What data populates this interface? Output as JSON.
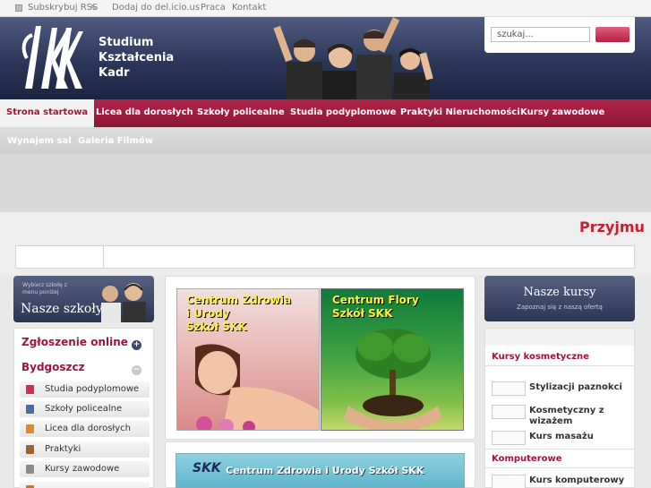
{
  "top_links": {
    "rss": "Subskrybuj RSS",
    "delicious": "Dodaj do del.icio.us",
    "praca": "Praca",
    "kontakt": "Kontakt"
  },
  "logo": {
    "mark": "SKK",
    "line1": "Studium",
    "line2": "Kształcenia",
    "line3": "Kadr"
  },
  "search": {
    "placeholder": "szukaj..."
  },
  "nav": {
    "row1": [
      "Strona startowa",
      "Licea dla dorosłych",
      "Szkoły policealne",
      "Studia podyplomowe",
      "Praktyki Nieruchomości",
      "Kursy zawodowe"
    ],
    "row2": [
      "Wynajem sal",
      "Galeria Filmów"
    ],
    "active": "Strona startowa"
  },
  "marquee": {
    "text": "Przyjmu"
  },
  "left_banner": {
    "small_line1": "Wybierz szkołę z",
    "small_line2": "menu poniżej",
    "title": "Nasze szkoły"
  },
  "left_panel": {
    "zgloszenie": "Zgłoszenie online",
    "city": "Bydgoszcz",
    "items": [
      {
        "label": "Studia podyplomowe",
        "icon": "book-icon"
      },
      {
        "label": "Szkoły policealne",
        "icon": "graduation-icon"
      },
      {
        "label": "Licea dla dorosłych",
        "icon": "school-icon"
      },
      {
        "label": "Praktyki",
        "icon": "briefcase-icon"
      },
      {
        "label": "Kursy zawodowe",
        "icon": "document-icon"
      }
    ]
  },
  "promos": {
    "zdrowie": {
      "line1": "Centrum Zdrowia",
      "line2": "i Urody",
      "line3": "Szkół SKK"
    },
    "flory": {
      "line1": "Centrum Flory",
      "line2": "Szkół SKK"
    },
    "banner3": {
      "logo": "SKK",
      "text": "Centrum Zdrowia i Urody Szkół SKK"
    }
  },
  "right_banner": {
    "title": "Nasze kursy",
    "subtitle": "Zapoznaj się z naszą ofertą"
  },
  "right_panel": {
    "section1": "Kursy kosmetyczne",
    "courses1": [
      "Stylizacji paznokci",
      "Kosmetyczny z wizażem",
      "Kurs masażu"
    ],
    "section2": "Komputerowe",
    "courses2": [
      "Kurs komputerowy"
    ]
  },
  "colors": {
    "brand_red": "#a0163a",
    "nav_red": "#b0254a",
    "header_navy": "#2c3658",
    "marquee_red": "#cc1d2d"
  }
}
